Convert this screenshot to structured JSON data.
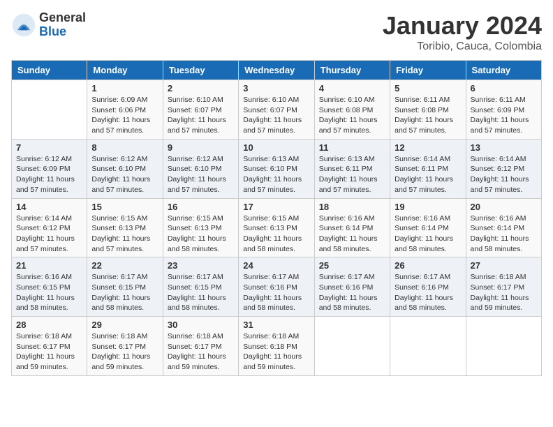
{
  "header": {
    "logo_general": "General",
    "logo_blue": "Blue",
    "month_title": "January 2024",
    "location": "Toribio, Cauca, Colombia"
  },
  "days_of_week": [
    "Sunday",
    "Monday",
    "Tuesday",
    "Wednesday",
    "Thursday",
    "Friday",
    "Saturday"
  ],
  "weeks": [
    [
      {
        "day": "",
        "info": ""
      },
      {
        "day": "1",
        "info": "Sunrise: 6:09 AM\nSunset: 6:06 PM\nDaylight: 11 hours\nand 57 minutes."
      },
      {
        "day": "2",
        "info": "Sunrise: 6:10 AM\nSunset: 6:07 PM\nDaylight: 11 hours\nand 57 minutes."
      },
      {
        "day": "3",
        "info": "Sunrise: 6:10 AM\nSunset: 6:07 PM\nDaylight: 11 hours\nand 57 minutes."
      },
      {
        "day": "4",
        "info": "Sunrise: 6:10 AM\nSunset: 6:08 PM\nDaylight: 11 hours\nand 57 minutes."
      },
      {
        "day": "5",
        "info": "Sunrise: 6:11 AM\nSunset: 6:08 PM\nDaylight: 11 hours\nand 57 minutes."
      },
      {
        "day": "6",
        "info": "Sunrise: 6:11 AM\nSunset: 6:09 PM\nDaylight: 11 hours\nand 57 minutes."
      }
    ],
    [
      {
        "day": "7",
        "info": "Sunrise: 6:12 AM\nSunset: 6:09 PM\nDaylight: 11 hours\nand 57 minutes."
      },
      {
        "day": "8",
        "info": "Sunrise: 6:12 AM\nSunset: 6:10 PM\nDaylight: 11 hours\nand 57 minutes."
      },
      {
        "day": "9",
        "info": "Sunrise: 6:12 AM\nSunset: 6:10 PM\nDaylight: 11 hours\nand 57 minutes."
      },
      {
        "day": "10",
        "info": "Sunrise: 6:13 AM\nSunset: 6:10 PM\nDaylight: 11 hours\nand 57 minutes."
      },
      {
        "day": "11",
        "info": "Sunrise: 6:13 AM\nSunset: 6:11 PM\nDaylight: 11 hours\nand 57 minutes."
      },
      {
        "day": "12",
        "info": "Sunrise: 6:14 AM\nSunset: 6:11 PM\nDaylight: 11 hours\nand 57 minutes."
      },
      {
        "day": "13",
        "info": "Sunrise: 6:14 AM\nSunset: 6:12 PM\nDaylight: 11 hours\nand 57 minutes."
      }
    ],
    [
      {
        "day": "14",
        "info": "Sunrise: 6:14 AM\nSunset: 6:12 PM\nDaylight: 11 hours\nand 57 minutes."
      },
      {
        "day": "15",
        "info": "Sunrise: 6:15 AM\nSunset: 6:13 PM\nDaylight: 11 hours\nand 57 minutes."
      },
      {
        "day": "16",
        "info": "Sunrise: 6:15 AM\nSunset: 6:13 PM\nDaylight: 11 hours\nand 58 minutes."
      },
      {
        "day": "17",
        "info": "Sunrise: 6:15 AM\nSunset: 6:13 PM\nDaylight: 11 hours\nand 58 minutes."
      },
      {
        "day": "18",
        "info": "Sunrise: 6:16 AM\nSunset: 6:14 PM\nDaylight: 11 hours\nand 58 minutes."
      },
      {
        "day": "19",
        "info": "Sunrise: 6:16 AM\nSunset: 6:14 PM\nDaylight: 11 hours\nand 58 minutes."
      },
      {
        "day": "20",
        "info": "Sunrise: 6:16 AM\nSunset: 6:14 PM\nDaylight: 11 hours\nand 58 minutes."
      }
    ],
    [
      {
        "day": "21",
        "info": "Sunrise: 6:16 AM\nSunset: 6:15 PM\nDaylight: 11 hours\nand 58 minutes."
      },
      {
        "day": "22",
        "info": "Sunrise: 6:17 AM\nSunset: 6:15 PM\nDaylight: 11 hours\nand 58 minutes."
      },
      {
        "day": "23",
        "info": "Sunrise: 6:17 AM\nSunset: 6:15 PM\nDaylight: 11 hours\nand 58 minutes."
      },
      {
        "day": "24",
        "info": "Sunrise: 6:17 AM\nSunset: 6:16 PM\nDaylight: 11 hours\nand 58 minutes."
      },
      {
        "day": "25",
        "info": "Sunrise: 6:17 AM\nSunset: 6:16 PM\nDaylight: 11 hours\nand 58 minutes."
      },
      {
        "day": "26",
        "info": "Sunrise: 6:17 AM\nSunset: 6:16 PM\nDaylight: 11 hours\nand 58 minutes."
      },
      {
        "day": "27",
        "info": "Sunrise: 6:18 AM\nSunset: 6:17 PM\nDaylight: 11 hours\nand 59 minutes."
      }
    ],
    [
      {
        "day": "28",
        "info": "Sunrise: 6:18 AM\nSunset: 6:17 PM\nDaylight: 11 hours\nand 59 minutes."
      },
      {
        "day": "29",
        "info": "Sunrise: 6:18 AM\nSunset: 6:17 PM\nDaylight: 11 hours\nand 59 minutes."
      },
      {
        "day": "30",
        "info": "Sunrise: 6:18 AM\nSunset: 6:17 PM\nDaylight: 11 hours\nand 59 minutes."
      },
      {
        "day": "31",
        "info": "Sunrise: 6:18 AM\nSunset: 6:18 PM\nDaylight: 11 hours\nand 59 minutes."
      },
      {
        "day": "",
        "info": ""
      },
      {
        "day": "",
        "info": ""
      },
      {
        "day": "",
        "info": ""
      }
    ]
  ]
}
